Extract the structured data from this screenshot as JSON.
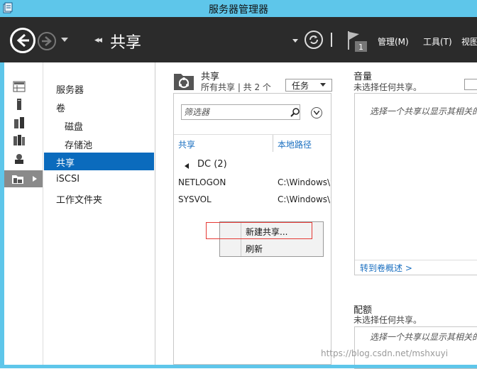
{
  "window": {
    "title": "服务器管理器"
  },
  "navbar": {
    "page_title": "共享",
    "breadcrumb_sep": "◂◂",
    "menu": {
      "manage": "管理(M)",
      "tools": "工具(T)",
      "view": "视图"
    },
    "flag_count": "1"
  },
  "icons": [
    "dashboard-icon",
    "local-server-icon",
    "all-servers-icon",
    "file-storage-icon",
    "ad-icon",
    "shares-icon"
  ],
  "nav": {
    "items": [
      {
        "label": "服务器"
      },
      {
        "label": "卷"
      },
      {
        "label": "磁盘"
      },
      {
        "label": "存储池"
      },
      {
        "label": "共享"
      },
      {
        "label": "iSCSI"
      },
      {
        "label": "工作文件夹"
      }
    ],
    "selected": "共享"
  },
  "shares": {
    "title": "共享",
    "subtitle": "所有共享 | 共 2 个",
    "tasks_label": "任务",
    "filter_placeholder": "筛选器",
    "columns": [
      "共享",
      "本地路径"
    ],
    "group": "DC (2)",
    "rows": [
      {
        "name": "NETLOGON",
        "path": "C:\\Windows\\SYSVOL"
      },
      {
        "name": "SYSVOL",
        "path": "C:\\Windows\\SYSVOL"
      }
    ]
  },
  "context_menu": {
    "items": [
      "新建共享...",
      "刷新"
    ]
  },
  "volume": {
    "title": "音量",
    "subtitle": "未选择任何共享。",
    "message": "选择一个共享以显示其相关的卷",
    "link": "转到卷概述 >"
  },
  "quota": {
    "title": "配额",
    "subtitle": "未选择任何共享。",
    "message": "选择一个共享以显示其相关的配额"
  },
  "watermark": "https://blog.csdn.net/mshxuyi",
  "colors": {
    "accent": "#0b6bbd",
    "titlebar": "#5ec6ea",
    "navbar": "#2b2b2b",
    "highlight": "#e53935"
  }
}
